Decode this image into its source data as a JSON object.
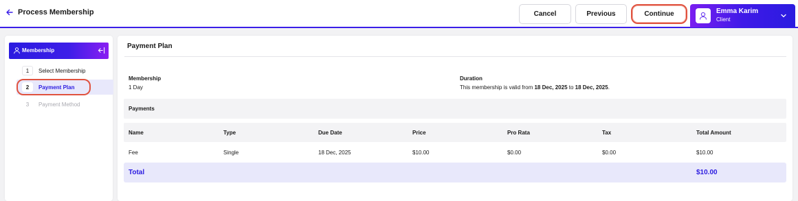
{
  "header": {
    "title": "Process Membership",
    "cancel_label": "Cancel",
    "previous_label": "Previous",
    "continue_label": "Continue",
    "user": {
      "name": "Emma Karim",
      "role": "Client"
    }
  },
  "sidebar": {
    "title": "Membership",
    "steps": [
      {
        "number": "1",
        "label": "Select Membership"
      },
      {
        "number": "2",
        "label": "Payment Plan"
      },
      {
        "number": "3",
        "label": "Payment Method"
      }
    ]
  },
  "main": {
    "section_title": "Payment Plan",
    "membership_label": "Membership",
    "membership_value": "1 Day",
    "duration_label": "Duration",
    "duration_prefix": "This membership is valid from ",
    "duration_start": "18 Dec, 2025",
    "duration_mid": " to ",
    "duration_end": "18 Dec, 2025",
    "duration_suffix": ".",
    "payments_title": "Payments",
    "table": {
      "headers": [
        "Name",
        "Type",
        "Due Date",
        "Price",
        "Pro Rata",
        "Tax",
        "Total Amount"
      ],
      "rows": [
        [
          "Fee",
          "Single",
          "18 Dec, 2025",
          "$10.00",
          "$0.00",
          "$0.00",
          "$10.00"
        ]
      ]
    },
    "total_label": "Total",
    "total_value": "$10.00"
  },
  "colors": {
    "accent": "#2b1be0",
    "accent_light": "#e8e8fb",
    "highlight_ring": "#e0523f"
  }
}
